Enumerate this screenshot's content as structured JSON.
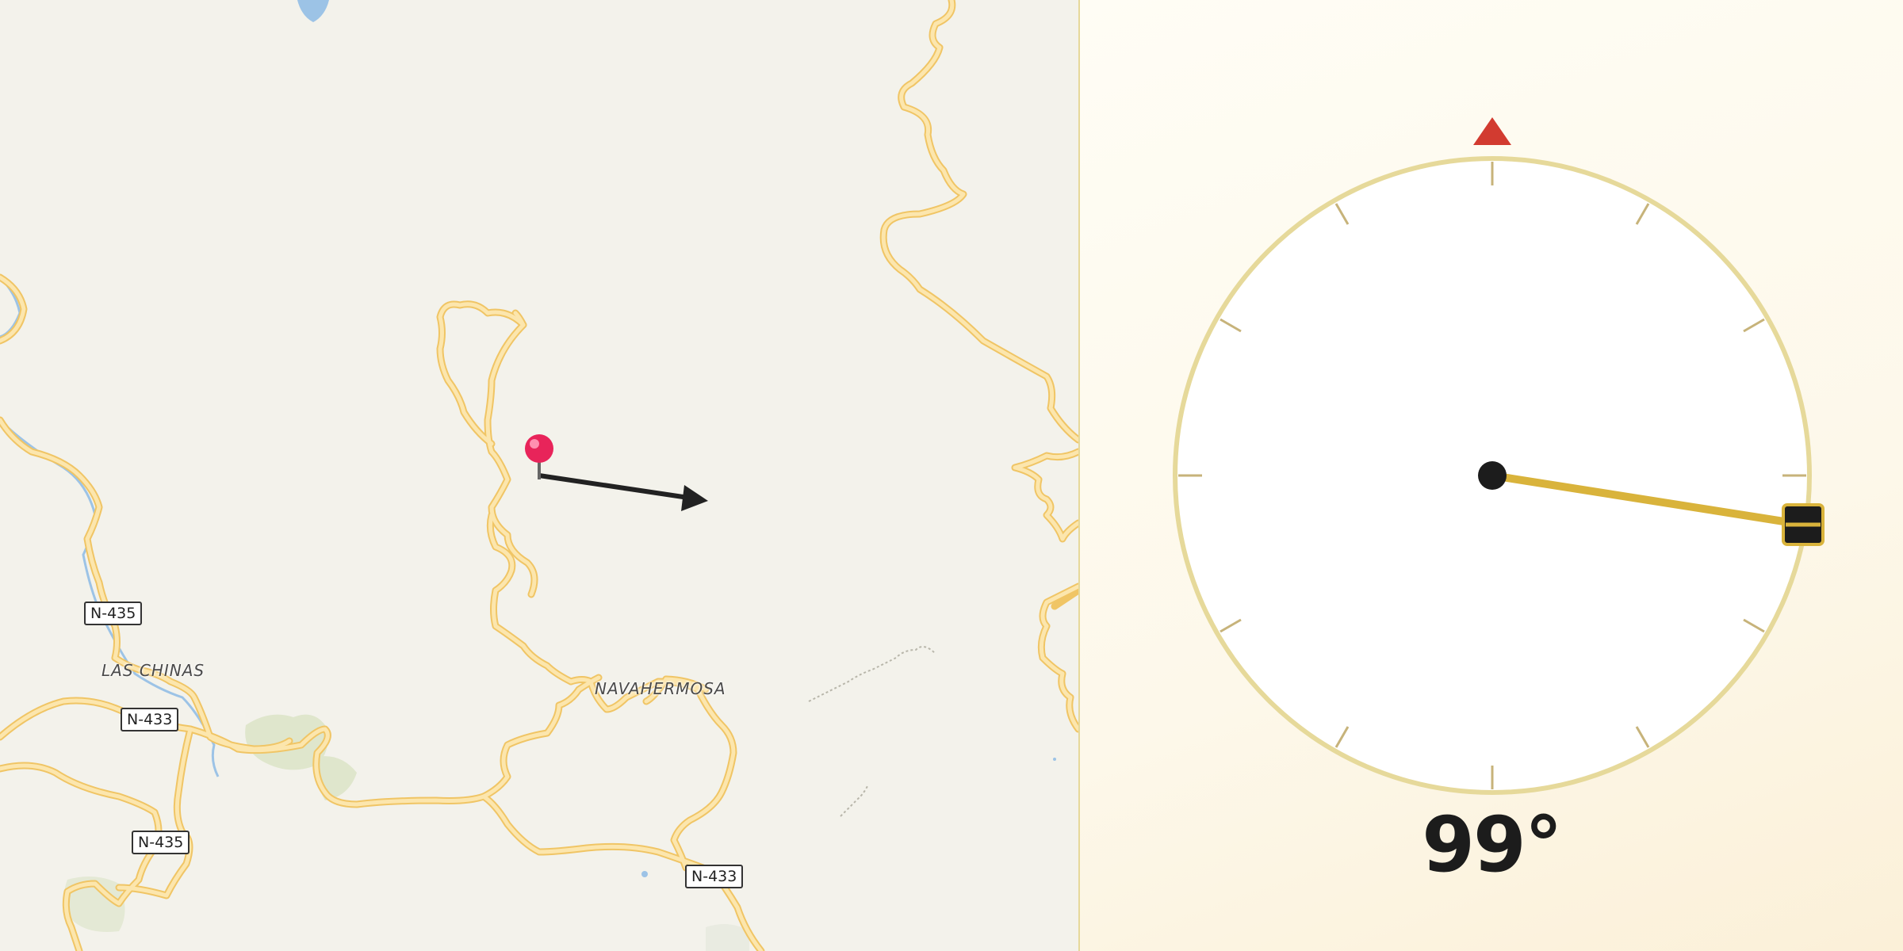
{
  "map": {
    "road_shields": [
      {
        "label": "N-435"
      },
      {
        "label": "N-433"
      },
      {
        "label": "N-435"
      },
      {
        "label": "N-433"
      }
    ],
    "places": [
      {
        "label": "LAS CHINAS"
      },
      {
        "label": "NAVAHERMOSA"
      }
    ],
    "colors": {
      "background": "#f3f2eb",
      "road_fill": "#fbe0a0",
      "road_casing": "#f0c565",
      "water": "#9cc3e6",
      "park": "#dfe6cc",
      "pin": "#e8245a",
      "arrow": "#222222"
    },
    "markers": [
      {
        "icon": "map-pin-icon"
      },
      {
        "icon": "direction-arrow-icon"
      }
    ]
  },
  "compass": {
    "heading_text": "99°",
    "heading_degrees": 99,
    "icons": [
      "north-marker-icon",
      "compass-needle-icon",
      "needle-handle-icon"
    ],
    "colors": {
      "ring": "#e6d99a",
      "tick": "#c7b37a",
      "north": "#d23b30",
      "needle": "#d9b33b",
      "hub": "#1c1c1c"
    }
  }
}
